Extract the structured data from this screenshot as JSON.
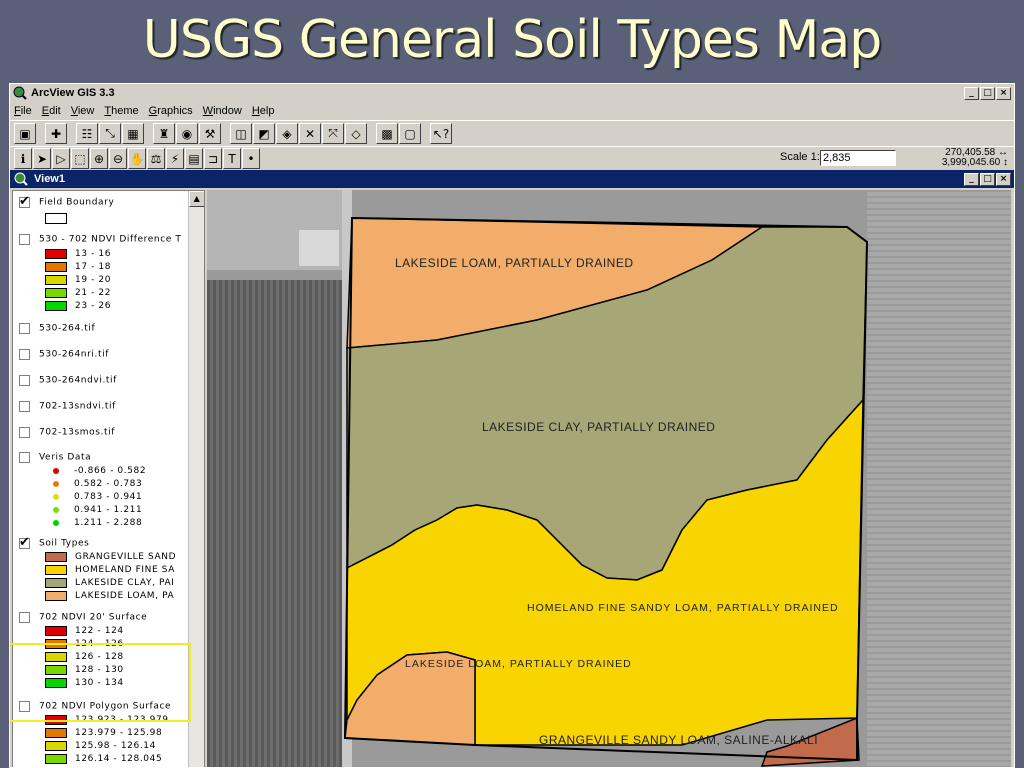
{
  "slide": {
    "title": "USGS General Soil Types Map"
  },
  "app": {
    "title": "ArcView GIS 3.3",
    "window_controls": [
      "_",
      "□",
      "×"
    ],
    "menus": [
      "File",
      "Edit",
      "View",
      "Theme",
      "Graphics",
      "Window",
      "Help"
    ],
    "toolbar_icons": [
      "save-icon",
      "add-theme-icon",
      "theme-properties-icon",
      "edit-legend-icon",
      "open-table-icon",
      "find-icon",
      "locate-icon",
      "query-builder-icon",
      "zoom-full-icon",
      "zoom-active-icon",
      "zoom-selected-icon",
      "zoom-in-fixed-icon",
      "zoom-out-fixed-icon",
      "zoom-previous-icon",
      "select-by-graphic-icon",
      "clear-selection-icon",
      "help-icon"
    ],
    "tools": [
      "identify-tool",
      "pointer-tool",
      "vertex-edit-tool",
      "zoom-in-tool",
      "zoom-out-tool",
      "pan-tool",
      "measure-tool",
      "hotlink-tool",
      "area-of-interest-tool",
      "label-tool",
      "text-tool",
      "draw-point-tool"
    ],
    "scale_label": "Scale 1:",
    "scale_value": "2,835",
    "coord_x": "270,405.58",
    "coord_y": "3,999,045.60"
  },
  "view": {
    "title": "View1"
  },
  "toc": {
    "field_boundary": {
      "name": "Field Boundary",
      "checked": true
    },
    "ndvi_diff": {
      "name": "530 - 702 NDVI Difference T",
      "checked": false,
      "classes": [
        {
          "label": "13 - 16",
          "color": "#e00000"
        },
        {
          "label": "17 - 18",
          "color": "#e07800"
        },
        {
          "label": "19 - 20",
          "color": "#d8d800"
        },
        {
          "label": "21 - 22",
          "color": "#78d800"
        },
        {
          "label": "23 - 26",
          "color": "#00d800"
        }
      ]
    },
    "images": [
      "530-264.tif",
      "530-264nri.tif",
      "530-264ndvi.tif",
      "702-13sndvi.tif",
      "702-13smos.tif"
    ],
    "veris": {
      "name": "Veris Data",
      "checked": false,
      "classes": [
        {
          "label": "-0.866 - 0.582",
          "color": "#e00000"
        },
        {
          "label": "0.582 - 0.783",
          "color": "#e08000"
        },
        {
          "label": "0.783 - 0.941",
          "color": "#e0e000"
        },
        {
          "label": "0.941 - 1.211",
          "color": "#78e000"
        },
        {
          "label": "1.211 - 2.288",
          "color": "#00d000"
        }
      ]
    },
    "soil": {
      "name": "Soil Types",
      "checked": true,
      "classes": [
        {
          "label": "GRANGEVILLE SAND",
          "color": "#c26a4c"
        },
        {
          "label": "HOMELAND FINE SA",
          "color": "#f8d400"
        },
        {
          "label": "LAKESIDE CLAY, PAI",
          "color": "#a6a677"
        },
        {
          "label": "LAKESIDE LOAM, PA",
          "color": "#f2ad6a"
        }
      ]
    },
    "ndvi20": {
      "name": "702 NDVI 20' Surface",
      "checked": false,
      "classes": [
        {
          "label": "122 - 124",
          "color": "#e00000"
        },
        {
          "label": "124 - 126",
          "color": "#e07800"
        },
        {
          "label": "126 - 128",
          "color": "#d8d800"
        },
        {
          "label": "128 - 130",
          "color": "#78d800"
        },
        {
          "label": "130 - 134",
          "color": "#00d800"
        }
      ]
    },
    "ndvi_poly": {
      "name": "702 NDVI Polygon Surface",
      "checked": false,
      "classes": [
        {
          "label": "123.923 - 123.979",
          "color": "#e00000"
        },
        {
          "label": "123.979 - 125.98",
          "color": "#e07800"
        },
        {
          "label": "125.98 - 126.14",
          "color": "#d8d800"
        },
        {
          "label": "126.14 - 128.045",
          "color": "#78d800"
        }
      ]
    }
  },
  "map_labels": {
    "loam_top": "LAKESIDE LOAM, PARTIALLY DRAINED",
    "clay": "LAKESIDE CLAY, PARTIALLY DRAINED",
    "homeland": "HOMELAND FINE SANDY LOAM, PARTIALLY DRAINED",
    "loam_bottom": "LAKESIDE LOAM, PARTIALLY DRAINED",
    "grangeville": "GRANGEVILLE SANDY LOAM, SALINE-ALKALI"
  },
  "colors": {
    "lakeside_loam": "#f2ad6a",
    "lakeside_clay": "#a6a677",
    "homeland": "#f8d400",
    "grangeville": "#c26a4c"
  }
}
